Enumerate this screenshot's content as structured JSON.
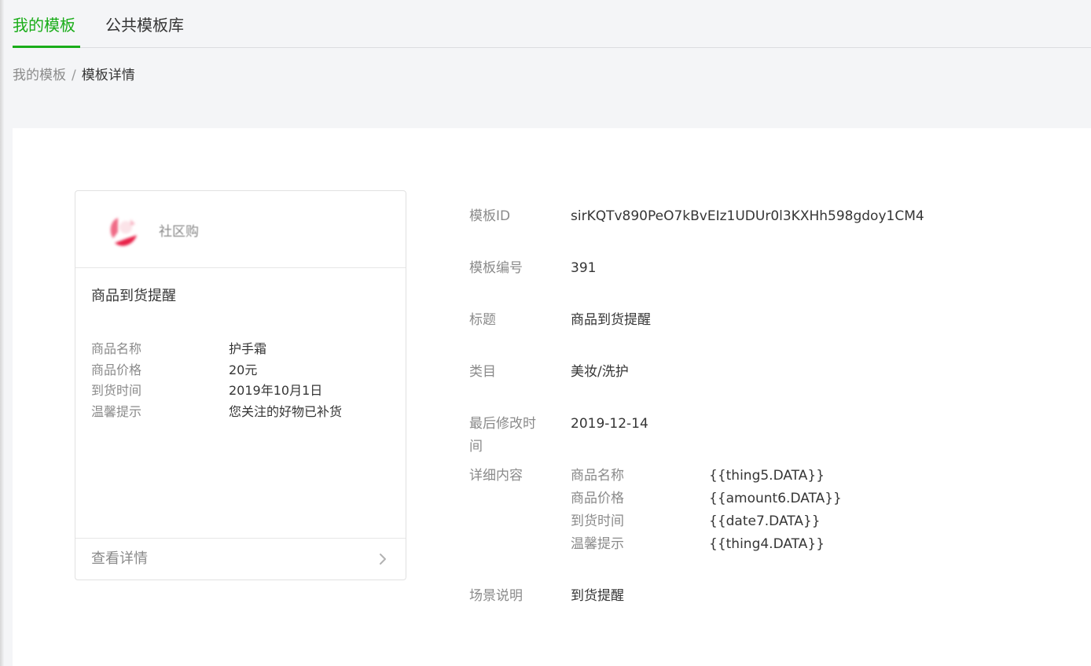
{
  "tabs": [
    {
      "label": "我的模板",
      "active": true
    },
    {
      "label": "公共模板库",
      "active": false
    }
  ],
  "breadcrumb": {
    "parent": "我的模板",
    "separator": "/",
    "current": "模板详情"
  },
  "preview_card": {
    "account_name": "社区购",
    "title": "商品到货提醒",
    "fields": [
      {
        "key": "商品名称",
        "value": "护手霜"
      },
      {
        "key": "商品价格",
        "value": "20元"
      },
      {
        "key": "到货时间",
        "value": "2019年10月1日"
      },
      {
        "key": "温馨提示",
        "value": "您关注的好物已补货"
      }
    ],
    "footer_label": "查看详情"
  },
  "details": {
    "template_id": {
      "label": "模板ID",
      "value": "sirKQTv890PeO7kBvEIz1UDUr0l3KXHh598gdoy1CM4"
    },
    "template_number": {
      "label": "模板编号",
      "value": "391"
    },
    "title": {
      "label": "标题",
      "value": "商品到货提醒"
    },
    "category": {
      "label": "类目",
      "value": "美妆/洗护"
    },
    "last_modified": {
      "label": "最后修改时间",
      "value": "2019-12-14"
    },
    "content": {
      "label": "详细内容",
      "keywords": [
        {
          "name": "商品名称",
          "value": "{{thing5.DATA}}"
        },
        {
          "name": "商品价格",
          "value": "{{amount6.DATA}}"
        },
        {
          "name": "到货时间",
          "value": "{{date7.DATA}}"
        },
        {
          "name": "温馨提示",
          "value": "{{thing4.DATA}}"
        }
      ]
    },
    "scene": {
      "label": "场景说明",
      "value": "到货提醒"
    }
  },
  "colors": {
    "accent": "#1aad19",
    "text_primary": "#353535",
    "text_secondary": "#8a8a8a",
    "page_background": "#f4f5f7",
    "panel_background": "#ffffff"
  },
  "icons": {
    "avatar": "blurred-red-logo",
    "footer": "chevron-right-icon"
  }
}
